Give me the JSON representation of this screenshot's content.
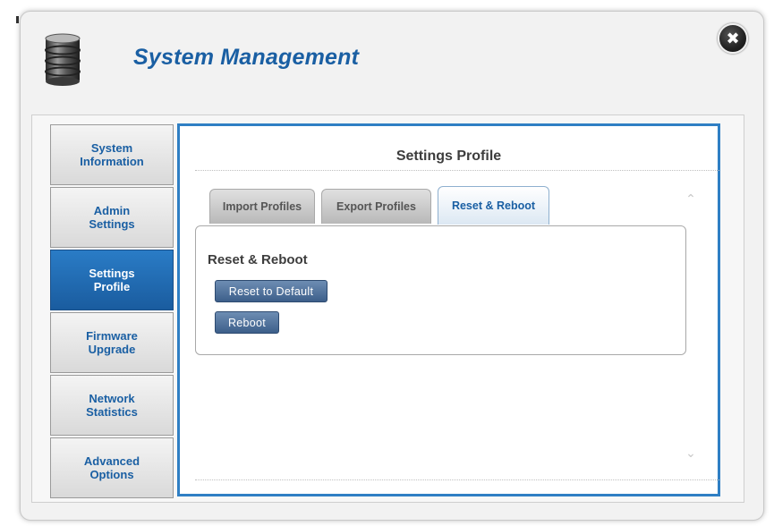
{
  "dialog": {
    "title": "System Management",
    "header_icon": "database-icon",
    "close_icon": "close-icon",
    "close_glyph": "✖"
  },
  "sidebar": {
    "items": [
      {
        "label": "System\nInformation",
        "active": false
      },
      {
        "label": "Admin\nSettings",
        "active": false
      },
      {
        "label": "Settings\nProfile",
        "active": true
      },
      {
        "label": "Firmware\nUpgrade",
        "active": false
      },
      {
        "label": "Network\nStatistics",
        "active": false
      },
      {
        "label": "Advanced\nOptions",
        "active": false
      }
    ]
  },
  "main": {
    "title": "Settings Profile",
    "tabs": [
      {
        "label": "Import Profiles",
        "active": false
      },
      {
        "label": "Export Profiles",
        "active": false
      },
      {
        "label": "Reset & Reboot",
        "active": true
      }
    ],
    "section_title": "Reset & Reboot",
    "reset_button_label": "Reset to Default",
    "reboot_button_label": "Reboot",
    "scroll_up_glyph": "⌃",
    "scroll_down_glyph": "⌄"
  },
  "colors": {
    "accent": "#1a5fa3",
    "active_sidebar": "#1f6cb3",
    "panel_border": "#2f7fc4",
    "button": "#4a6d96"
  }
}
